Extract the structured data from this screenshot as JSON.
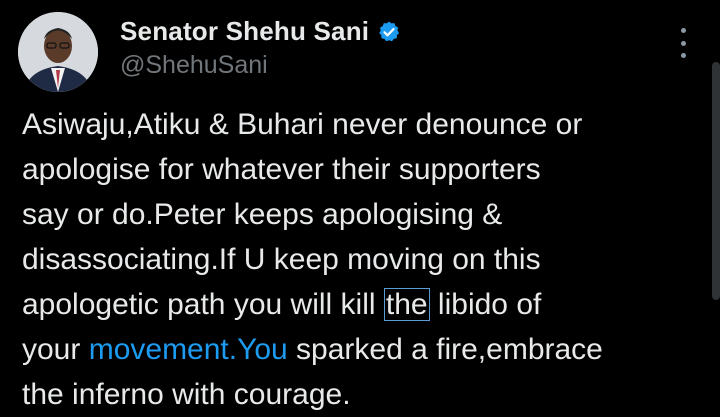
{
  "author": {
    "name": "Senator Shehu Sani",
    "handle": "@ShehuSani",
    "verified_icon": "verified-badge-icon",
    "avatar_icon": "profile-photo"
  },
  "menu": {
    "icon": "more-options-icon"
  },
  "tweet": {
    "line1": "Asiwaju,Atiku & Buhari never denounce or",
    "line2": "apologise for whatever their supporters",
    "line3": "say or do.Peter keeps apologising &",
    "line4": "disassociating.If U keep moving on this",
    "line5_pre": "apologetic path you will kill ",
    "line5_highlight": "the",
    "line5_post": " libido of",
    "line6_pre": "your ",
    "line6_link": "movement.You",
    "line6_post": " sparked a fire,embrace",
    "line7": "the inferno with courage."
  },
  "colors": {
    "background": "#000000",
    "text": "#e7e9ea",
    "handle": "#71767b",
    "link": "#1d9bf0",
    "verified": "#1d9bf0"
  }
}
